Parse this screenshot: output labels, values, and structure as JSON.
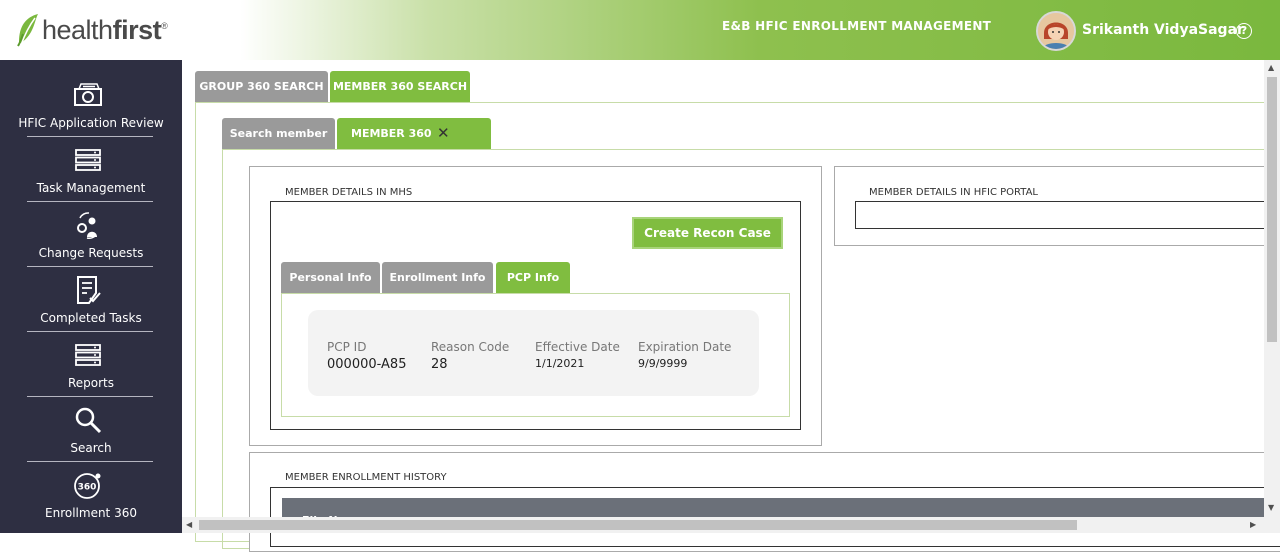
{
  "header": {
    "logo_light": "health",
    "logo_bold": "first",
    "logo_reg": "®",
    "app_title": "E&B HFIC ENROLLMENT MANAGEMENT",
    "user_name": "Srikanth VidyaSagar",
    "help_label": "?"
  },
  "sidebar": {
    "items": [
      {
        "label": "HFIC Application Review",
        "icon": "application-review-icon"
      },
      {
        "label": "Task Management",
        "icon": "server-list-icon"
      },
      {
        "label": "Change Requests",
        "icon": "change-requests-icon"
      },
      {
        "label": "Completed Tasks",
        "icon": "completed-tasks-icon"
      },
      {
        "label": "Reports",
        "icon": "server-list-icon"
      },
      {
        "label": "Search",
        "icon": "search-icon"
      },
      {
        "label": "Enrollment 360",
        "icon": "enrollment-360-icon",
        "icon_text": "360"
      }
    ]
  },
  "outer_tabs": {
    "group_search": "GROUP 360 SEARCH",
    "member_search": "MEMBER 360 SEARCH"
  },
  "inner_tabs": {
    "search_member": "Search member",
    "member_360": "MEMBER 360",
    "close": "✕"
  },
  "mhs": {
    "legend": "MEMBER DETAILS IN MHS",
    "recon_button": "Create Recon Case",
    "tabs": {
      "personal": "Personal Info",
      "enrollment": "Enrollment Info",
      "pcp": "PCP Info"
    },
    "pcp": {
      "id_label": "PCP ID",
      "id_value": "000000-A85",
      "reason_label": "Reason Code",
      "reason_value": "28",
      "effective_label": "Effective Date",
      "effective_value": "1/1/2021",
      "expiration_label": "Expiration Date",
      "expiration_value": "9/9/9999"
    }
  },
  "portal": {
    "legend": "MEMBER DETAILS IN HFIC PORTAL"
  },
  "history": {
    "legend": "MEMBER ENROLLMENT HISTORY",
    "first_column": "File Name"
  },
  "colors": {
    "accent_green": "#80bd40",
    "sidebar_bg": "#2e2f42",
    "inactive_tab": "#9a9a9a"
  }
}
